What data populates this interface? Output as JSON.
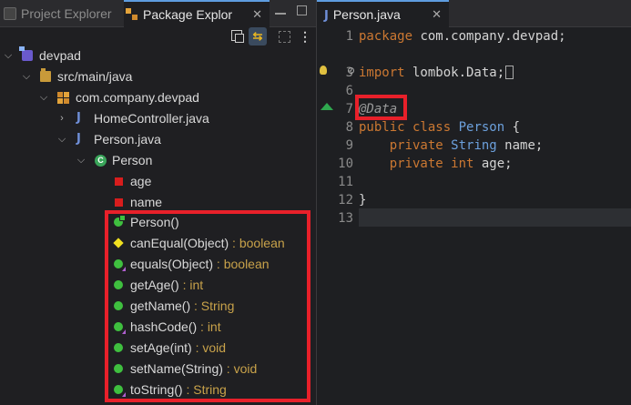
{
  "left_panel": {
    "tabs": [
      {
        "label": "Project Explorer",
        "active": false
      },
      {
        "label": "Package Explor",
        "active": true,
        "close": "✕"
      }
    ],
    "toolbar": {
      "collapse_all": "collapse-all-icon",
      "link_with_editor": "⇆",
      "focus": "focus-icon",
      "more": "⋮"
    },
    "tree": {
      "project": "devpad",
      "source_folder": "src/main/java",
      "package": "com.company.devpad",
      "files": [
        {
          "name": "HomeController.java"
        },
        {
          "name": "Person.java"
        }
      ],
      "class_name": "Person",
      "fields": [
        "age",
        "name"
      ],
      "methods": [
        {
          "name": "Person()",
          "return": ""
        },
        {
          "name": "canEqual(Object)",
          "return": " : boolean"
        },
        {
          "name": "equals(Object)",
          "return": " : boolean"
        },
        {
          "name": "getAge()",
          "return": " : int"
        },
        {
          "name": "getName()",
          "return": " : String"
        },
        {
          "name": "hashCode()",
          "return": " : int"
        },
        {
          "name": "setAge(int)",
          "return": " : void"
        },
        {
          "name": "setName(String)",
          "return": " : void"
        },
        {
          "name": "toString()",
          "return": " : String"
        }
      ]
    }
  },
  "editor": {
    "tab": {
      "label": "Person.java",
      "close": "✕"
    },
    "line_numbers": [
      "1",
      "3",
      "6",
      "7",
      "8",
      "9",
      "10",
      "11",
      "12",
      "13"
    ],
    "fold_marker": "⊕",
    "lines": {
      "l1_kw": "package",
      "l1_rest": " com.company.devpad;",
      "l3_kw": "import",
      "l3_rest": " lombok.Data;",
      "l7_ann": "@Data",
      "l8_kw1": "public",
      "l8_kw2": " class",
      "l8_name": " Person",
      "l8_rest": " {",
      "l9_kw": "private",
      "l9_type": " String",
      "l9_var": " name",
      "l9_end": ";",
      "l10_kw": "private",
      "l10_type": " int",
      "l10_var": " age",
      "l10_end": ";",
      "l12": "}"
    }
  },
  "colors": {
    "highlight": "#e8202a",
    "keyword": "#cc7832",
    "type": "#6ca0dc",
    "return_type": "#c8a24a"
  }
}
